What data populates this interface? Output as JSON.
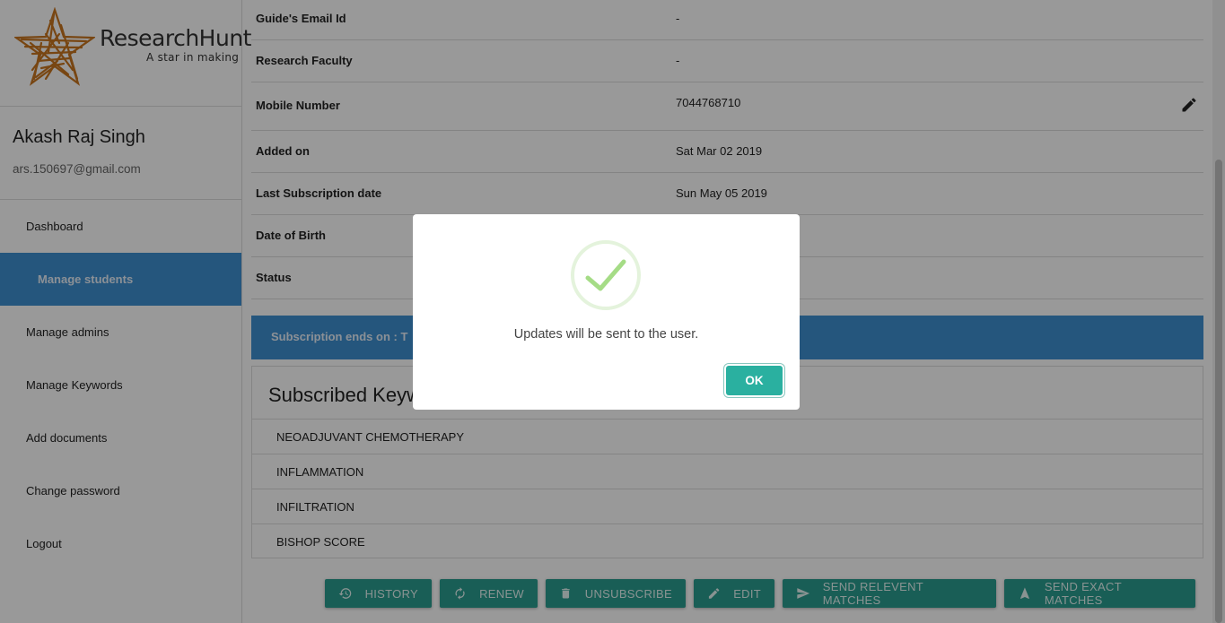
{
  "brand": {
    "title": "ResearchHunt",
    "tagline": "A star in making",
    "star_color": "#d07a2a"
  },
  "user": {
    "name": "Akash Raj Singh",
    "email": "ars.150697@gmail.com"
  },
  "nav": [
    {
      "label": "Dashboard"
    },
    {
      "label": "Manage students"
    },
    {
      "label": "Manage admins"
    },
    {
      "label": "Manage Keywords"
    },
    {
      "label": "Add documents"
    },
    {
      "label": "Change password"
    },
    {
      "label": "Logout"
    }
  ],
  "details": [
    {
      "label": "Guide's Email Id",
      "value": "-"
    },
    {
      "label": "Research Faculty",
      "value": "-"
    },
    {
      "label": "Mobile Number",
      "value": "7044768710"
    },
    {
      "label": "Added on",
      "value": "Sat Mar 02 2019"
    },
    {
      "label": "Last Subscription date",
      "value": "Sun May 05 2019"
    },
    {
      "label": "Date of Birth",
      "value": ""
    },
    {
      "label": "Status",
      "value": ""
    }
  ],
  "subscription_banner": "Subscription ends on : T",
  "keywords": {
    "title": "Subscribed Keyw",
    "items": [
      "NEOADJUVANT CHEMOTHERAPY",
      "INFLAMMATION",
      "INFILTRATION",
      "BISHOP SCORE"
    ]
  },
  "actions": {
    "history": "HISTORY",
    "renew": "RENEW",
    "unsubscribe": "UNSUBSCRIBE",
    "edit": "EDIT",
    "send_relevant": "SEND RELEVENT MATCHES",
    "send_exact": "SEND EXACT MATCHES"
  },
  "modal": {
    "message": "Updates will be sent to the user.",
    "ok_label": "OK",
    "icon": "success-check-icon"
  },
  "colors": {
    "accent_blue": "#3e8fd0",
    "teal_button": "#2a9d8f",
    "ok_button": "#2ab0a0",
    "success_green": "#a5dc86"
  }
}
